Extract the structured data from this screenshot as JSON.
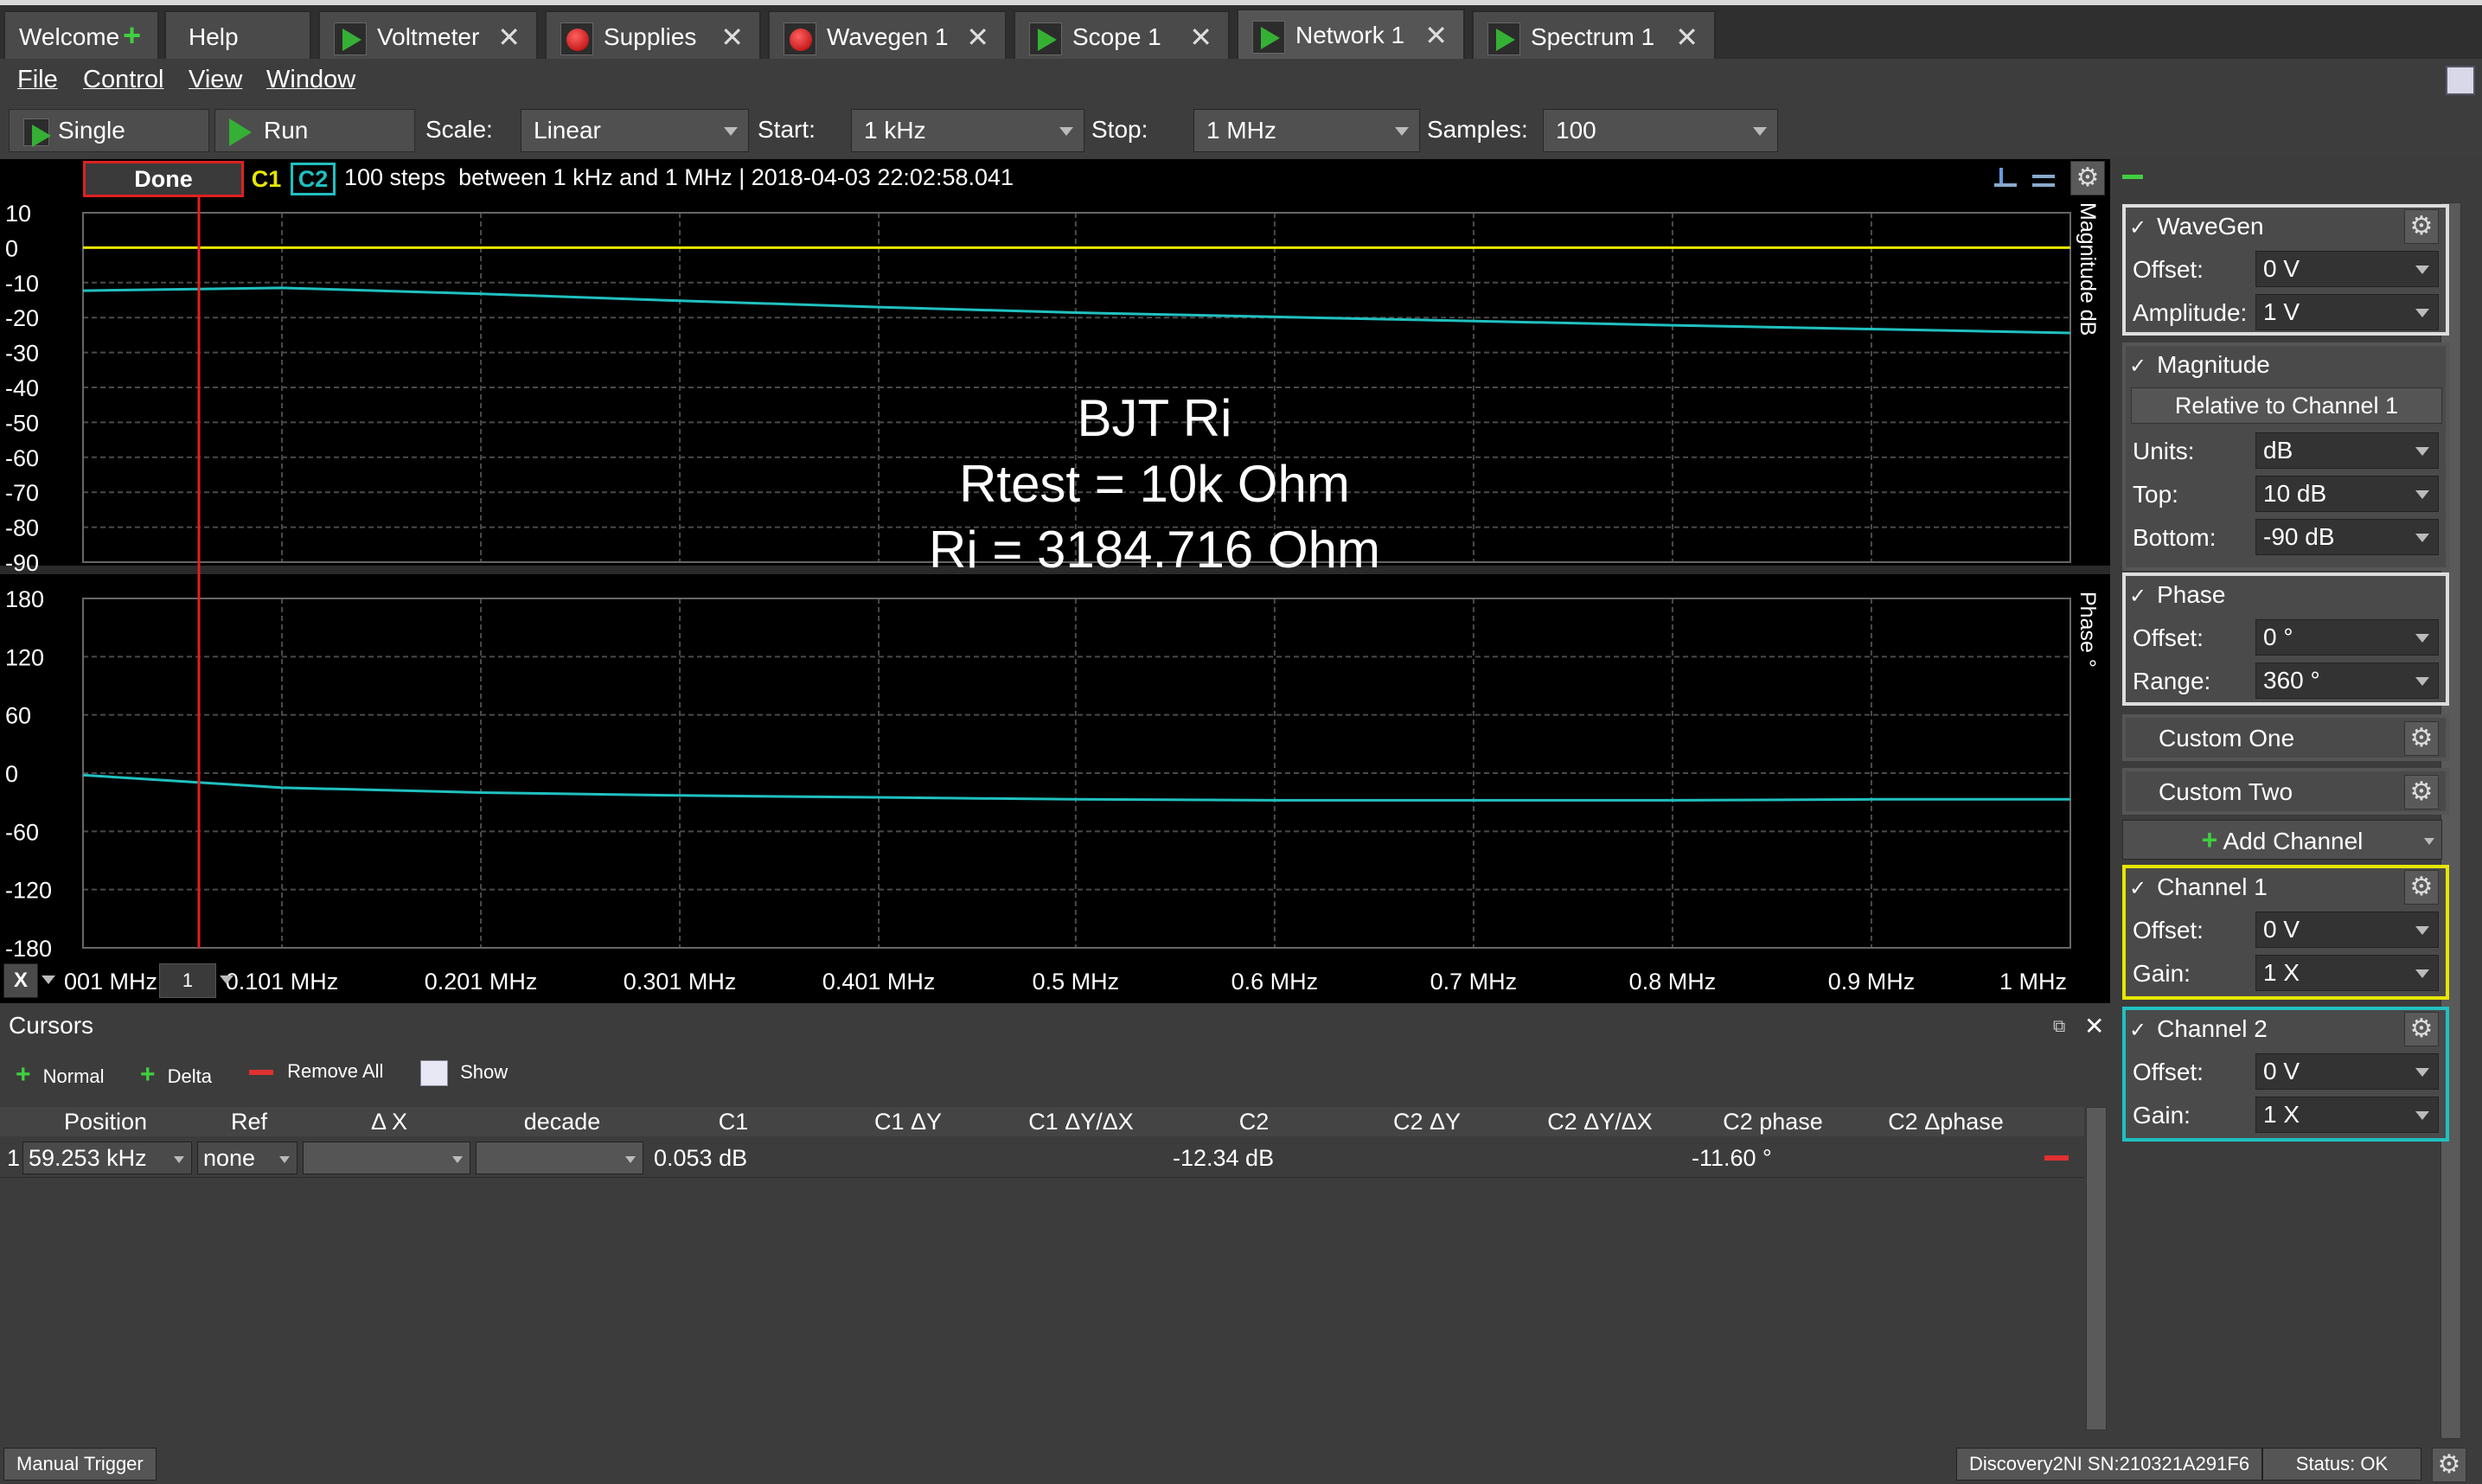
{
  "tabs": [
    {
      "label": "Welcome",
      "icon": "plus-icon"
    },
    {
      "label": "Help",
      "icon": ""
    },
    {
      "label": "Voltmeter",
      "icon": "play-icon"
    },
    {
      "label": "Supplies",
      "icon": "stop-icon"
    },
    {
      "label": "Wavegen 1",
      "icon": "stop-icon"
    },
    {
      "label": "Scope 1",
      "icon": "play-icon"
    },
    {
      "label": "Network 1",
      "icon": "play-icon"
    },
    {
      "label": "Spectrum 1",
      "icon": "play-icon"
    }
  ],
  "menu": {
    "file": "File",
    "control": "Control",
    "view": "View",
    "window": "Window"
  },
  "toolbar": {
    "single": "Single",
    "run": "Run",
    "scale_label": "Scale:",
    "scale_value": "Linear",
    "start_label": "Start:",
    "start_value": "1 kHz",
    "stop_label": "Stop:",
    "stop_value": "1 MHz",
    "samples_label": "Samples:",
    "samples_value": "100"
  },
  "plot": {
    "status": "Done",
    "c1": "C1",
    "c2": "C2",
    "info": "100 steps  between 1 kHz and 1 MHz | 2018-04-03 22:02:58.041",
    "annotation1": "BJT Ri",
    "annotation2": "Rtest = 10k Ohm",
    "annotation3": "Ri = 3184.716 Ohm",
    "mag_axis_label": "Magnitude dB",
    "phase_axis_label": "Phase °",
    "mag_ticks": [
      "10",
      "0",
      "-10",
      "-20",
      "-30",
      "-40",
      "-50",
      "-60",
      "-70",
      "-80",
      "-90"
    ],
    "phase_ticks": [
      "180",
      "120",
      "60",
      "0",
      "-60",
      "-120",
      "-180"
    ],
    "x_ticks": [
      "001 MHz",
      "0.101 MHz",
      "0.201 MHz",
      "0.301 MHz",
      "0.401 MHz",
      "0.5 MHz",
      "0.6 MHz",
      "0.7 MHz",
      "0.8 MHz",
      "0.9 MHz",
      "1 MHz"
    ],
    "x_btn": "X",
    "x_spin": "1",
    "colors": {
      "c1": "#e6e600",
      "c2": "#20c0c0",
      "cursor": "#e02020"
    }
  },
  "chart_data": {
    "type": "line",
    "x_unit": "MHz",
    "x": [
      0.001,
      0.101,
      0.201,
      0.301,
      0.401,
      0.5,
      0.6,
      0.7,
      0.8,
      0.9,
      1.0
    ],
    "series": [
      {
        "name": "C1",
        "values": [
          0,
          0,
          0,
          0,
          0,
          0,
          0,
          0,
          0,
          0,
          0
        ]
      },
      {
        "name": "C2",
        "values": [
          -12.3,
          -11.5,
          -13.2,
          -15.2,
          -17.0,
          -18.6,
          -19.8,
          -21.0,
          -22.2,
          -23.3,
          -24.4
        ]
      },
      {
        "name": "C2 phase",
        "values": [
          -2,
          -15,
          -20,
          -23,
          -25,
          -27,
          -28,
          -28,
          -28,
          -27,
          -27
        ]
      }
    ],
    "ylim_mag": [
      -90,
      10
    ],
    "ylim_phase": [
      -180,
      180
    ],
    "xlim": [
      0.001,
      1.0
    ],
    "grid": true
  },
  "rightpanel": {
    "wavegen": {
      "title": "WaveGen",
      "offset_label": "Offset:",
      "offset": "0 V",
      "amplitude_label": "Amplitude:",
      "amplitude": "1 V"
    },
    "magnitude": {
      "title": "Magnitude",
      "relative": "Relative to Channel 1",
      "units_label": "Units:",
      "units": "dB",
      "top_label": "Top:",
      "top": "10 dB",
      "bottom_label": "Bottom:",
      "bottom": "-90 dB"
    },
    "phase": {
      "title": "Phase",
      "offset_label": "Offset:",
      "offset": "0 °",
      "range_label": "Range:",
      "range": "360 °"
    },
    "custom_one": "Custom One",
    "custom_two": "Custom Two",
    "add_channel": "Add Channel",
    "channel1": {
      "title": "Channel 1",
      "offset_label": "Offset:",
      "offset": "0 V",
      "gain_label": "Gain:",
      "gain": "1 X",
      "color": "#e6e600"
    },
    "channel2": {
      "title": "Channel 2",
      "offset_label": "Offset:",
      "offset": "0 V",
      "gain_label": "Gain:",
      "gain": "1 X",
      "color": "#20c0c0"
    }
  },
  "cursors": {
    "title": "Cursors",
    "normal": "Normal",
    "delta": "Delta",
    "remove_all": "Remove All",
    "show": "Show",
    "headers": [
      "Position",
      "Ref",
      "Δ X",
      "decade",
      "C1",
      "C1 ΔY",
      "C1 ΔY/ΔX",
      "C2",
      "C2 ΔY",
      "C2 ΔY/ΔX",
      "C2 phase",
      "C2 Δphase"
    ],
    "row": {
      "index": "1",
      "position": "59.253 kHz",
      "ref": "none",
      "c1": "0.053 dB",
      "c2": "-12.34 dB",
      "c2_phase": "-11.60 °"
    }
  },
  "statusbar": {
    "manual_trigger": "Manual Trigger",
    "device": "Discovery2NI SN:210321A291F6",
    "status": "Status: OK"
  }
}
